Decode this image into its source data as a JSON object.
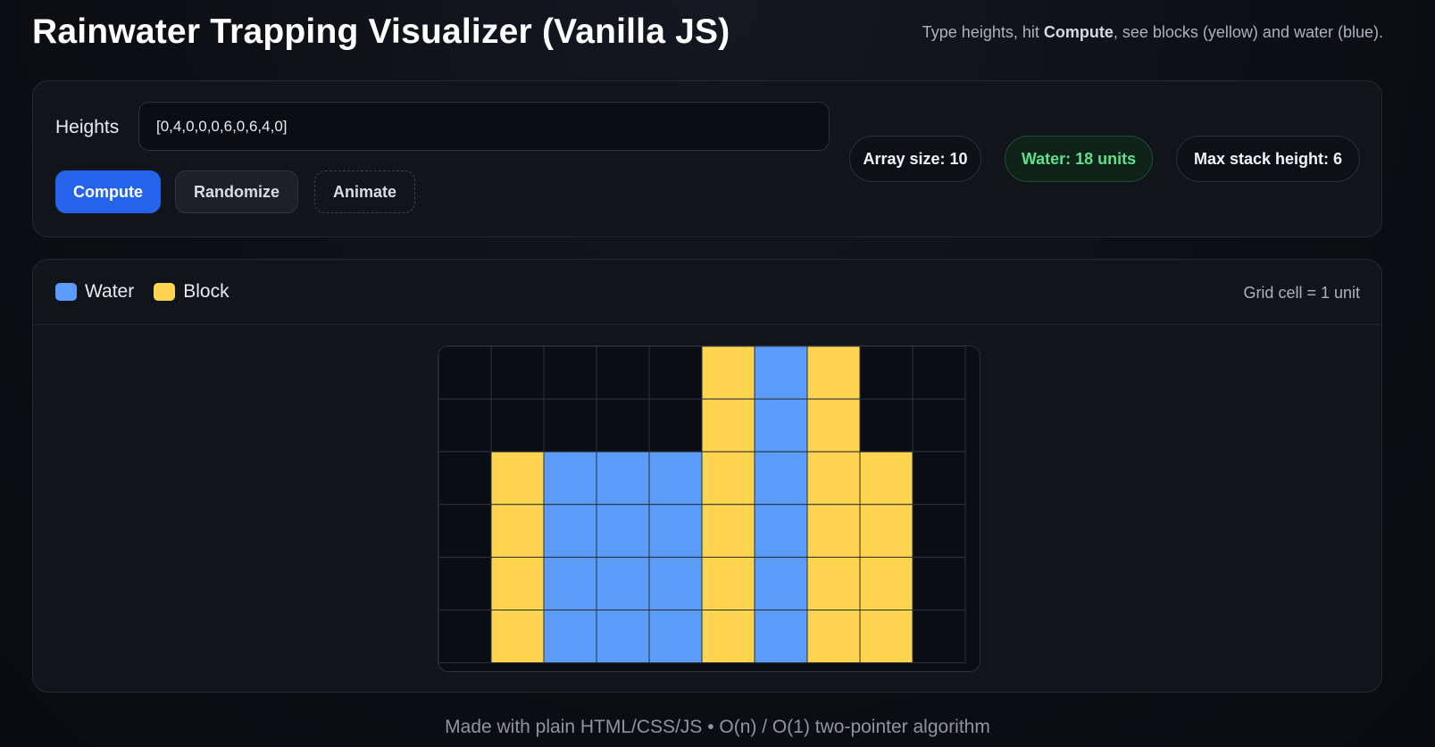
{
  "header": {
    "title": "Rainwater Trapping Visualizer (Vanilla JS)",
    "subtitle_pre": "Type heights, hit ",
    "subtitle_bold": "Compute",
    "subtitle_post": ", see blocks (yellow) and water (blue)."
  },
  "controls": {
    "heights_label": "Heights",
    "heights_value": "[0,4,0,0,0,6,0,6,4,0]",
    "compute_label": "Compute",
    "randomize_label": "Randomize",
    "animate_label": "Animate"
  },
  "stats": {
    "array_size": "Array size: 10",
    "water": "Water: 18 units",
    "max_height": "Max stack height: 6"
  },
  "legend": {
    "water_label": "Water",
    "block_label": "Block",
    "grid_note": "Grid cell = 1 unit"
  },
  "visualization": {
    "heights": [
      0,
      4,
      0,
      0,
      0,
      6,
      0,
      6,
      4,
      0
    ],
    "water": [
      0,
      0,
      4,
      4,
      4,
      0,
      6,
      0,
      0,
      0
    ],
    "max_height": 6,
    "colors": {
      "water": "#5b9cf8",
      "block": "#ffd54f",
      "empty": "#0a0d13",
      "gridline": "#2b3240"
    }
  },
  "footer": {
    "text": "Made with plain HTML/CSS/JS • O(n) / O(1) two-pointer algorithm"
  }
}
